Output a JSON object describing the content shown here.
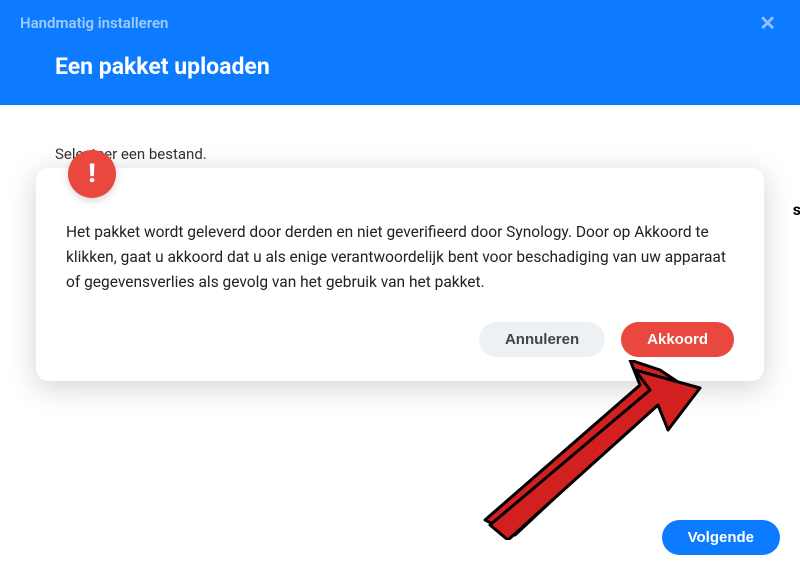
{
  "header": {
    "top_title": "Handmatig installeren",
    "close_glyph": "✕",
    "main_title": "Een pakket uploaden"
  },
  "body": {
    "instruction": "Selecteer een bestand."
  },
  "modal": {
    "warn_glyph": "!",
    "message": "Het pakket wordt geleverd door derden en niet geverifieerd door Synology. Door op Akkoord te klikken, gaat u akkoord dat u als enige verantwoordelijk bent voor beschadiging van uw apparaat of gegevensverlies als gevolg van het gebruik van het pakket.",
    "cancel_label": "Annuleren",
    "accept_label": "Akkoord"
  },
  "footer": {
    "next_label": "Volgende"
  },
  "bg_fragment": "s"
}
